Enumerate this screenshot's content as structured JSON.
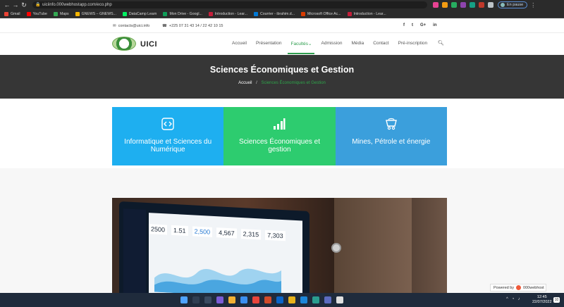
{
  "browser": {
    "url": "uiciinfo.000webhostapp.com/eco.php",
    "profile_label": "En pause"
  },
  "bookmarks": [
    {
      "label": "Gmail",
      "color": "#ea4335"
    },
    {
      "label": "YouTube",
      "color": "#ff0000"
    },
    {
      "label": "Maps",
      "color": "#34a853"
    },
    {
      "label": "GNEWS – GNEWS...",
      "color": "#f4b400"
    },
    {
      "label": "DataCamp Learn",
      "color": "#03ef62"
    },
    {
      "label": "Mon Drive - Googl...",
      "color": "#0f9d58"
    },
    {
      "label": "Introduction - Lear...",
      "color": "#c41e3a"
    },
    {
      "label": "Courrier - ibrahim.d...",
      "color": "#0078d4"
    },
    {
      "label": "Microsoft Office Ac...",
      "color": "#d83b01"
    },
    {
      "label": "Introduction - Lear...",
      "color": "#c41e3a"
    }
  ],
  "topbar": {
    "email": "contacts@uici.info",
    "phone": "+225 07 31 43 14 / 22 42 10 15",
    "social": [
      "f",
      "t",
      "G+",
      "in"
    ]
  },
  "header": {
    "brand": "UICI",
    "menu": [
      {
        "label": "Accueil",
        "active": false
      },
      {
        "label": "Présentation",
        "active": false
      },
      {
        "label": "Facultés",
        "active": true
      },
      {
        "label": "Admission",
        "active": false
      },
      {
        "label": "Média",
        "active": false
      },
      {
        "label": "Contact",
        "active": false
      },
      {
        "label": "Pré-inscription",
        "active": false
      }
    ],
    "accent": "#2e9e4e"
  },
  "banner": {
    "title": "Sciences Économiques et Gestion",
    "breadcrumb_home": "Accueil",
    "breadcrumb_sep": "/",
    "breadcrumb_current": "Sciences Économiques et Gestion"
  },
  "faculties": [
    {
      "label": "Informatique et Sciences du Numérique",
      "icon": "code-icon",
      "color": "#1eaff0"
    },
    {
      "label": "Sciences Économiques et gestion",
      "icon": "bar-chart-icon",
      "color": "#2dcc6f"
    },
    {
      "label": "Mines, Pétrole et énergie",
      "icon": "mine-cart-icon",
      "color": "#3b9fdc"
    }
  ],
  "photo": {
    "dashboard_metrics": [
      "2500",
      "1.51",
      "2,500",
      "4,567",
      "2,315",
      "7,303"
    ]
  },
  "powered": {
    "label": "Powered by",
    "brand": "000webhost"
  },
  "taskbar": {
    "time": "12:45",
    "date": "22/07/2022",
    "notifications": "10"
  }
}
